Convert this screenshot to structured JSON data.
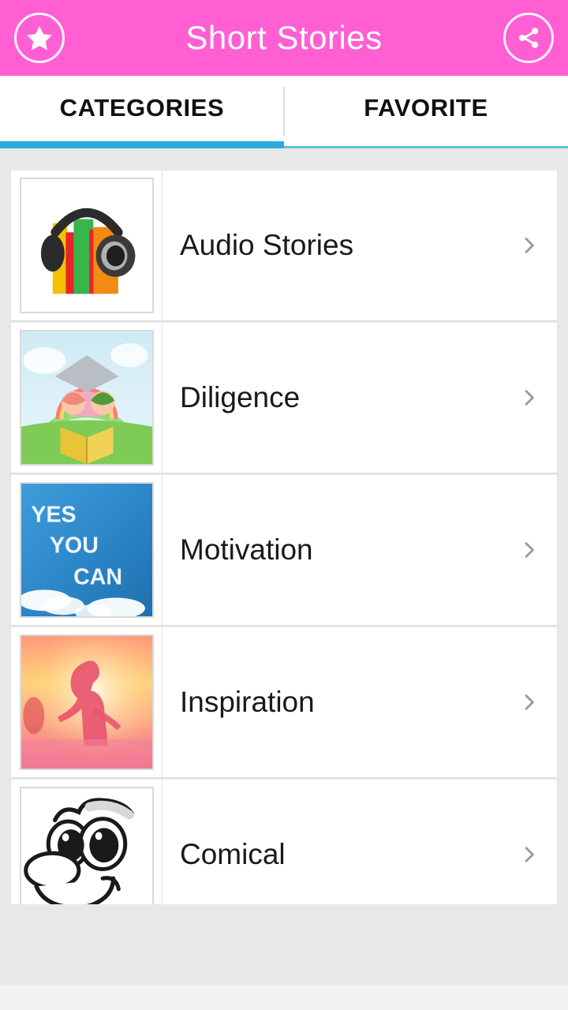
{
  "theme": {
    "header_bg": "#ff5fd2",
    "header_text": "#ffffff",
    "tab_active_underline": "#29abe2",
    "tab_inactive_underline": "#5dbfe6",
    "page_bg": "#e8e8e8",
    "card_bg": "#ffffff",
    "label_text": "#1a1a1a",
    "chevron": "#9a9a9a"
  },
  "header": {
    "title": "Short Stories",
    "left_icon": "star-icon",
    "right_icon": "share-icon"
  },
  "tabs": {
    "items": [
      {
        "label": "CATEGORIES",
        "active": true
      },
      {
        "label": "FAVORITE",
        "active": false
      }
    ]
  },
  "list": {
    "chevron_icon": "chevron-right-icon",
    "items": [
      {
        "label": "Audio Stories",
        "thumbnail": "audiobook-headphones-thumbnail"
      },
      {
        "label": "Diligence",
        "thumbnail": "children-reading-book-thumbnail"
      },
      {
        "label": "Motivation",
        "thumbnail": "yes-you-can-sky-thumbnail"
      },
      {
        "label": "Inspiration",
        "thumbnail": "woman-sunset-arms-open-thumbnail"
      },
      {
        "label": "Comical",
        "thumbnail": "cartoon-smiling-face-thumbnail"
      }
    ]
  }
}
